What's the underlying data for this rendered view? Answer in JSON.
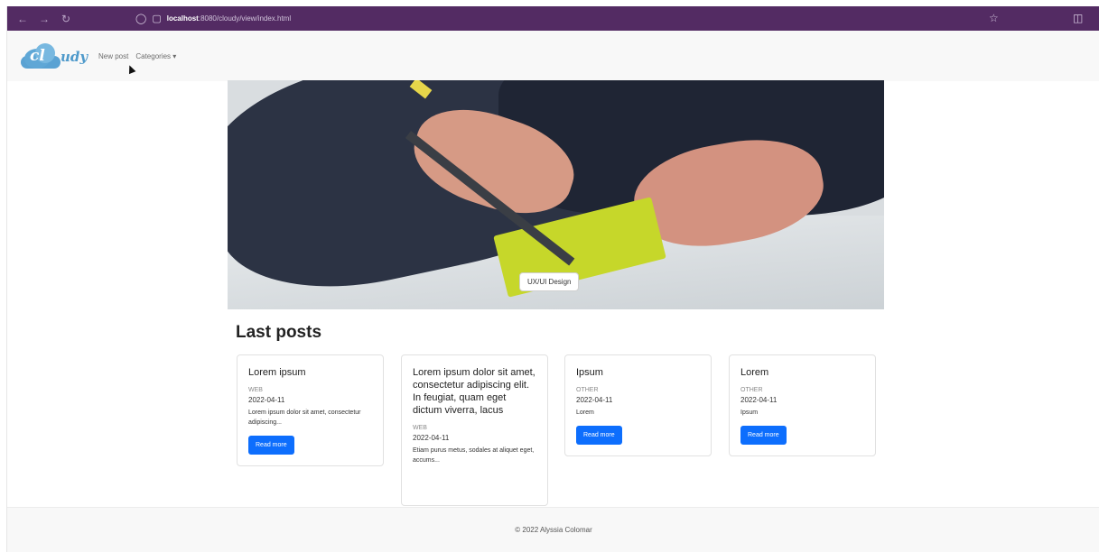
{
  "browser": {
    "url_host": "localhost",
    "url_rest": ":8080/cloudy/view/index.html",
    "back_icon": "back-arrow-icon",
    "forward_icon": "forward-arrow-icon",
    "reload_icon": "reload-icon"
  },
  "nav": {
    "logo_text": "cloudy",
    "links": [
      "New post",
      "Categories ▾"
    ]
  },
  "hero": {
    "badge": "UX/UI Design"
  },
  "section": {
    "title": "Last posts"
  },
  "posts": [
    {
      "title": "Lorem ipsum",
      "category": "WEB",
      "date": "2022-04-11",
      "excerpt": "Lorem ipsum dolor sit amet, consectetur adipiscing...",
      "button": "Read more"
    },
    {
      "title": "Lorem ipsum dolor sit amet, consectetur adipiscing elit. In feugiat, quam eget dictum viverra, lacus",
      "category": "WEB",
      "date": "2022-04-11",
      "excerpt": "Etiam purus metus, sodales at aliquet eget, accums...",
      "button": ""
    },
    {
      "title": "Ipsum",
      "category": "OTHER",
      "date": "2022-04-11",
      "excerpt": "Lorem",
      "button": "Read more"
    },
    {
      "title": "Lorem",
      "category": "OTHER",
      "date": "2022-04-11",
      "excerpt": "Ipsum",
      "button": "Read more"
    }
  ],
  "footer": {
    "text": "© 2022 Alyssia Colomar"
  }
}
